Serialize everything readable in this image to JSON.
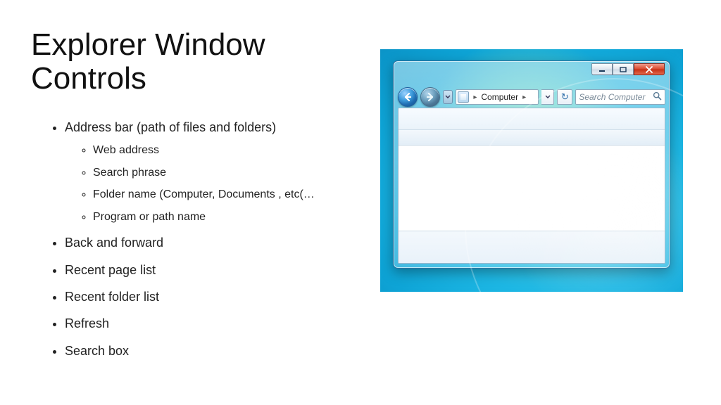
{
  "title": "Explorer Window Controls",
  "bullets": {
    "b0": "Address bar (path of files and folders)",
    "s0": "Web address",
    "s1": "Search phrase",
    "s2": "Folder name (Computer, Documents , etc(…",
    "s3": "Program or path name",
    "b1": "Back and forward",
    "b2": "Recent page list",
    "b3": "Recent folder list",
    "b4": "Refresh",
    "b5": "Search box"
  },
  "explorer": {
    "breadcrumb_root": "Computer",
    "search_placeholder": "Search Computer",
    "refresh_glyph": "↻",
    "caption": {
      "min": "—",
      "max": "▢",
      "close": "✕"
    }
  }
}
